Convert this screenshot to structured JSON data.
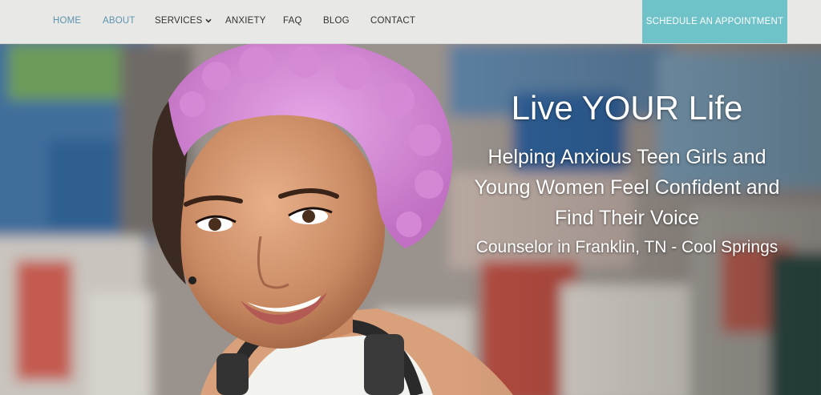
{
  "nav": {
    "items": [
      {
        "label": "HOME",
        "state": "active"
      },
      {
        "label": "ABOUT",
        "state": "hover"
      },
      {
        "label": "SERVICES",
        "has_dropdown": true,
        "icon": "chevron-down-icon"
      },
      {
        "label": "ANXIETY"
      },
      {
        "label": "FAQ"
      },
      {
        "label": "BLOG"
      },
      {
        "label": "CONTACT"
      }
    ],
    "cta_label": "SCHEDULE AN APPOINTMENT"
  },
  "hero": {
    "title": "Live YOUR Life",
    "subtitle_lines": [
      "Helping Anxious Teen Girls and",
      "Young Women Feel Confident and",
      "Find Their Voice"
    ],
    "location": "Counselor in Franklin, TN - Cool Springs"
  },
  "colors": {
    "header_bg": "#e8e8e6",
    "nav_text": "#333333",
    "nav_active": "#5b93ad",
    "cta_bg": "#6fc3c8",
    "cta_text": "#ffffff",
    "hero_text": "#ffffff"
  }
}
